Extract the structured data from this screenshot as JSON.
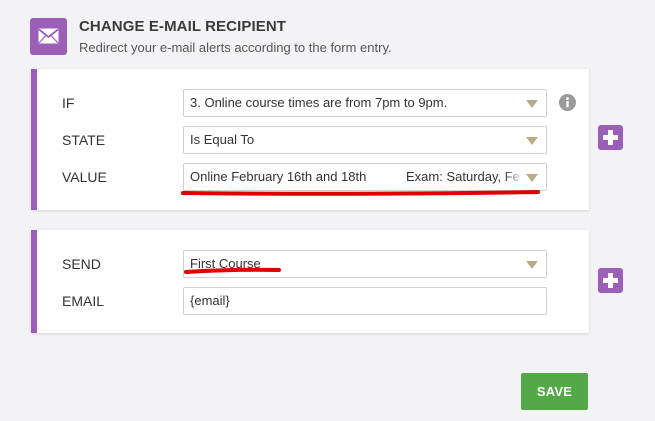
{
  "header": {
    "title": "CHANGE E-MAIL RECIPIENT",
    "subtitle": "Redirect your e-mail alerts according to the form entry.",
    "icon": "envelope-icon"
  },
  "condition": {
    "if": {
      "label": "IF",
      "value": "3. Online course times are from 7pm to 9pm."
    },
    "state": {
      "label": "STATE",
      "value": "Is Equal To"
    },
    "value": {
      "label": "VALUE",
      "value_part1": "Online February 16th and 18th",
      "value_part2": "Exam: Saturday, Fe"
    }
  },
  "action": {
    "send": {
      "label": "SEND",
      "value": "First Course"
    },
    "email": {
      "label": "EMAIL",
      "value": "{email}"
    }
  },
  "buttons": {
    "save": "SAVE"
  },
  "colors": {
    "accent": "#9c5fb8",
    "save": "#54a947",
    "annotation": "#e00000"
  }
}
